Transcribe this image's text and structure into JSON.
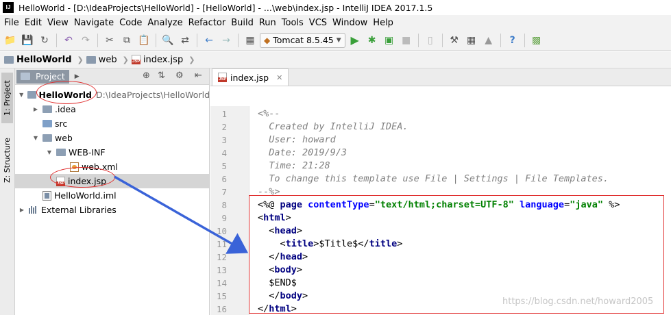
{
  "titlebar": {
    "app_icon": "IJ",
    "title": "HelloWorld - [D:\\IdeaProjects\\HelloWorld] - [HelloWorld] - ...\\web\\index.jsp - IntelliJ IDEA 2017.1.5"
  },
  "menu": [
    "File",
    "Edit",
    "View",
    "Navigate",
    "Code",
    "Analyze",
    "Refactor",
    "Build",
    "Run",
    "Tools",
    "VCS",
    "Window",
    "Help"
  ],
  "toolbar": {
    "run_config": "Tomcat 8.5.45",
    "icons": [
      "open-icon",
      "save-icon",
      "sync-icon",
      "undo-icon",
      "redo-icon",
      "cut-icon",
      "copy-icon",
      "paste-icon",
      "find-icon",
      "replace-icon",
      "back-icon",
      "forward-icon",
      "build-icon",
      "run-icon",
      "debug-icon",
      "coverage-icon",
      "stop-icon",
      "vcs-icon",
      "project-structure-icon",
      "settings-icon",
      "sdk-icon",
      "help-icon",
      "android-icon"
    ]
  },
  "breadcrumb": [
    "HelloWorld",
    "web",
    "index.jsp"
  ],
  "left_strip": {
    "project_tab": "1: Project",
    "structure_tab": "Z: Structure"
  },
  "project_panel": {
    "tab_label": "Project",
    "tree": [
      {
        "label": "HelloWorld",
        "path": "D:\\IdeaProjects\\HelloWorld",
        "type": "module",
        "depth": 0,
        "expanded": true
      },
      {
        "label": ".idea",
        "type": "folder",
        "depth": 1,
        "expanded": false
      },
      {
        "label": "src",
        "type": "folder-src",
        "depth": 1,
        "expanded": null
      },
      {
        "label": "web",
        "type": "folder-web",
        "depth": 1,
        "expanded": true
      },
      {
        "label": "WEB-INF",
        "type": "folder",
        "depth": 2,
        "expanded": true
      },
      {
        "label": "web.xml",
        "type": "xml",
        "depth": 3
      },
      {
        "label": "index.jsp",
        "type": "jsp",
        "depth": 2,
        "selected": true
      },
      {
        "label": "HelloWorld.iml",
        "type": "iml",
        "depth": 1
      },
      {
        "label": "External Libraries",
        "type": "libs",
        "depth": 0,
        "expanded": false
      }
    ]
  },
  "editor": {
    "tab_label": "index.jsp",
    "lines": [
      {
        "n": "1",
        "segs": [
          [
            "cm",
            "<%--"
          ]
        ]
      },
      {
        "n": "2",
        "segs": [
          [
            "cm",
            "  Created by IntelliJ IDEA."
          ]
        ]
      },
      {
        "n": "3",
        "segs": [
          [
            "cm",
            "  User: howard"
          ]
        ]
      },
      {
        "n": "4",
        "segs": [
          [
            "cm",
            "  Date: 2019/9/3"
          ]
        ]
      },
      {
        "n": "5",
        "segs": [
          [
            "cm",
            "  Time: 21:28"
          ]
        ]
      },
      {
        "n": "6",
        "segs": [
          [
            "cm",
            "  To change this template use File | Settings | File Templates."
          ]
        ]
      },
      {
        "n": "7",
        "segs": [
          [
            "cm",
            "--%>"
          ]
        ]
      },
      {
        "n": "8",
        "segs": [
          [
            "pl",
            "<%@ "
          ],
          [
            "kw",
            "page "
          ],
          [
            "at",
            "contentType"
          ],
          [
            "pl",
            "="
          ],
          [
            "st",
            "\"text/html;charset=UTF-8\" "
          ],
          [
            "at",
            "language"
          ],
          [
            "pl",
            "="
          ],
          [
            "st",
            "\"java\""
          ],
          [
            "pl",
            " %>"
          ]
        ]
      },
      {
        "n": "9",
        "segs": [
          [
            "pl",
            "<"
          ],
          [
            "kw",
            "html"
          ],
          [
            "pl",
            ">"
          ]
        ]
      },
      {
        "n": "10",
        "segs": [
          [
            "pl",
            "  <"
          ],
          [
            "kw",
            "head"
          ],
          [
            "pl",
            ">"
          ]
        ]
      },
      {
        "n": "11",
        "segs": [
          [
            "pl",
            "    <"
          ],
          [
            "kw",
            "title"
          ],
          [
            "pl",
            ">$Title$</"
          ],
          [
            "kw",
            "title"
          ],
          [
            "pl",
            ">"
          ]
        ]
      },
      {
        "n": "12",
        "segs": [
          [
            "pl",
            "  </"
          ],
          [
            "kw",
            "head"
          ],
          [
            "pl",
            ">"
          ]
        ]
      },
      {
        "n": "13",
        "segs": [
          [
            "pl",
            "  <"
          ],
          [
            "kw",
            "body"
          ],
          [
            "pl",
            ">"
          ]
        ]
      },
      {
        "n": "14",
        "segs": [
          [
            "pl",
            "  $END$"
          ]
        ]
      },
      {
        "n": "15",
        "segs": [
          [
            "pl",
            "  </"
          ],
          [
            "kw",
            "body"
          ],
          [
            "pl",
            ">"
          ]
        ]
      },
      {
        "n": "16",
        "segs": [
          [
            "pl",
            "</"
          ],
          [
            "kw",
            "html"
          ],
          [
            "pl",
            ">"
          ]
        ]
      }
    ]
  },
  "watermark": "https://blog.csdn.net/howard2005",
  "colors": {
    "annotation_red": "#e03030",
    "arrow_blue": "#3a63d8"
  }
}
